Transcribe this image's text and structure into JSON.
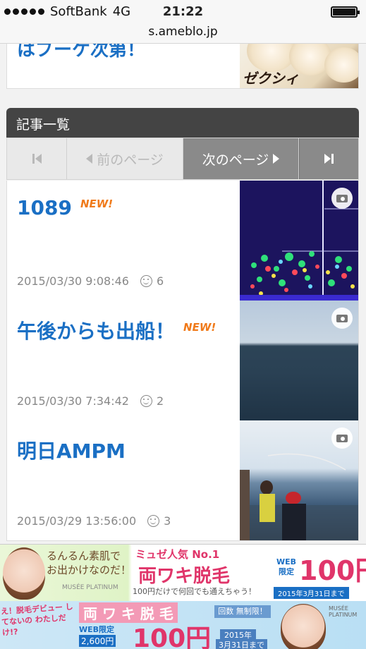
{
  "status_bar": {
    "carrier": "SoftBank",
    "network": "4G",
    "time": "21:22"
  },
  "url": "s.ameblo.jp",
  "previous_card": {
    "title_partial": "はブーケ次第！",
    "thumb_text": "ゼクシィ"
  },
  "list": {
    "header": "記事一覧",
    "pager": {
      "prev_label": "前のページ",
      "next_label": "次のページ"
    },
    "entries": [
      {
        "title": "1089",
        "new_badge": "NEW!",
        "date": "2015/03/30 9:08:46",
        "comments": "6"
      },
      {
        "title": "午後からも出船！",
        "new_badge": "NEW!",
        "date": "2015/03/30 7:34:42",
        "comments": "2"
      },
      {
        "title": "明日AMPM",
        "new_badge": "",
        "date": "2015/03/29 13:56:00",
        "comments": "3"
      }
    ]
  },
  "ads": {
    "ad1": {
      "catch": "るんるん素肌で\nお出かけなのだ！",
      "brand": "MUSÉE PLATINUM",
      "popular": "ミュゼ人気 No.1",
      "headline": "両ワキ脱毛",
      "web_label": "WEB 限定",
      "price": "100円",
      "sub": "100円だけで何回でも通えちゃう！",
      "deadline": "2015年3月31日まで"
    },
    "ad2": {
      "catch": "え！脱毛デビュー してないの わたしだけ!?",
      "headline": "両 ワ キ 脱 毛",
      "web_label": "WEB限定",
      "was_price": "2,600円",
      "price": "100円",
      "unlimited": "回数 無制限！",
      "year": "2015年",
      "deadline": "3月31日まで",
      "brand": "MUSÉE PLATINUM"
    }
  }
}
